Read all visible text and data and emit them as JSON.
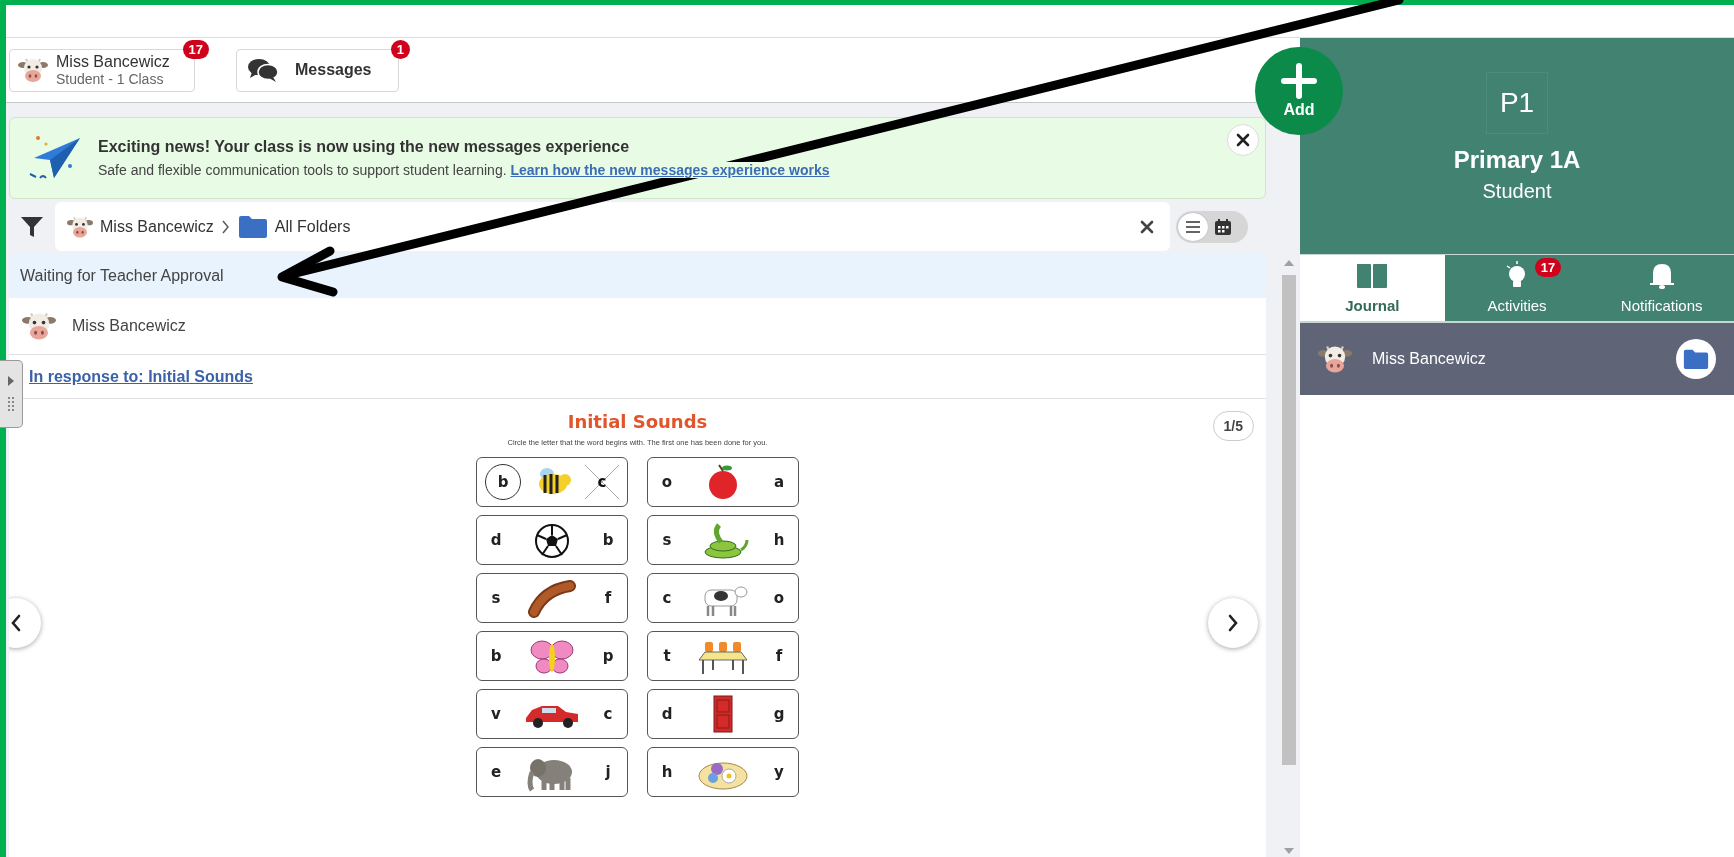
{
  "header": {
    "profile": {
      "name": "Miss Bancewicz",
      "subtitle": "Student - 1 Class",
      "badge": "17"
    },
    "messages": {
      "label": "Messages",
      "badge": "1"
    }
  },
  "banner": {
    "title": "Exciting news! Your class is now using the new messages experience",
    "text": "Safe and flexible communication tools to support student learning.",
    "link": "Learn how the new messages experience works"
  },
  "breadcrumb": [
    {
      "label": "Miss Bancewicz",
      "kind": "person"
    },
    {
      "label": "All Folders",
      "kind": "folder"
    }
  ],
  "view_toggle": [
    {
      "kind": "list",
      "selected": true
    },
    {
      "kind": "calendar",
      "selected": false
    }
  ],
  "post": {
    "status": "Waiting for Teacher Approval",
    "author": "Miss Bancewicz",
    "response_link": "In response to: Initial Sounds",
    "page": "1/5"
  },
  "worksheet": {
    "title": "Initial Sounds",
    "instructions": "Circle the letter that the word begins with. The first one has been done for you.",
    "cards": [
      {
        "left": "b",
        "right": "c",
        "left_circled": true,
        "right_crossed": true
      },
      {
        "left": "o",
        "right": "a",
        "left_circled": false,
        "right_crossed": false
      },
      {
        "left": "d",
        "right": "b",
        "left_circled": false,
        "right_crossed": false
      },
      {
        "left": "s",
        "right": "h",
        "left_circled": false,
        "right_crossed": false
      },
      {
        "left": "s",
        "right": "f",
        "left_circled": false,
        "right_crossed": false
      },
      {
        "left": "c",
        "right": "o",
        "left_circled": false,
        "right_crossed": false
      },
      {
        "left": "b",
        "right": "p",
        "left_circled": false,
        "right_crossed": false
      },
      {
        "left": "t",
        "right": "f",
        "left_circled": false,
        "right_crossed": false
      },
      {
        "left": "v",
        "right": "c",
        "left_circled": false,
        "right_crossed": false
      },
      {
        "left": "d",
        "right": "g",
        "left_circled": false,
        "right_crossed": false
      },
      {
        "left": "e",
        "right": "j",
        "left_circled": false,
        "right_crossed": false
      },
      {
        "left": "h",
        "right": "y",
        "left_circled": false,
        "right_crossed": false
      }
    ]
  },
  "add_button": {
    "label": "Add"
  },
  "class_panel": {
    "code": "P1",
    "name": "Primary 1A",
    "role": "Student"
  },
  "tabs": [
    {
      "label": "Journal",
      "kind": "journal",
      "selected": true
    },
    {
      "label": "Activities",
      "kind": "activities",
      "selected": false,
      "badge": "17"
    },
    {
      "label": "Notifications",
      "kind": "notifications",
      "selected": false
    }
  ],
  "journal_items": [
    {
      "name": "Miss Bancewicz"
    }
  ]
}
